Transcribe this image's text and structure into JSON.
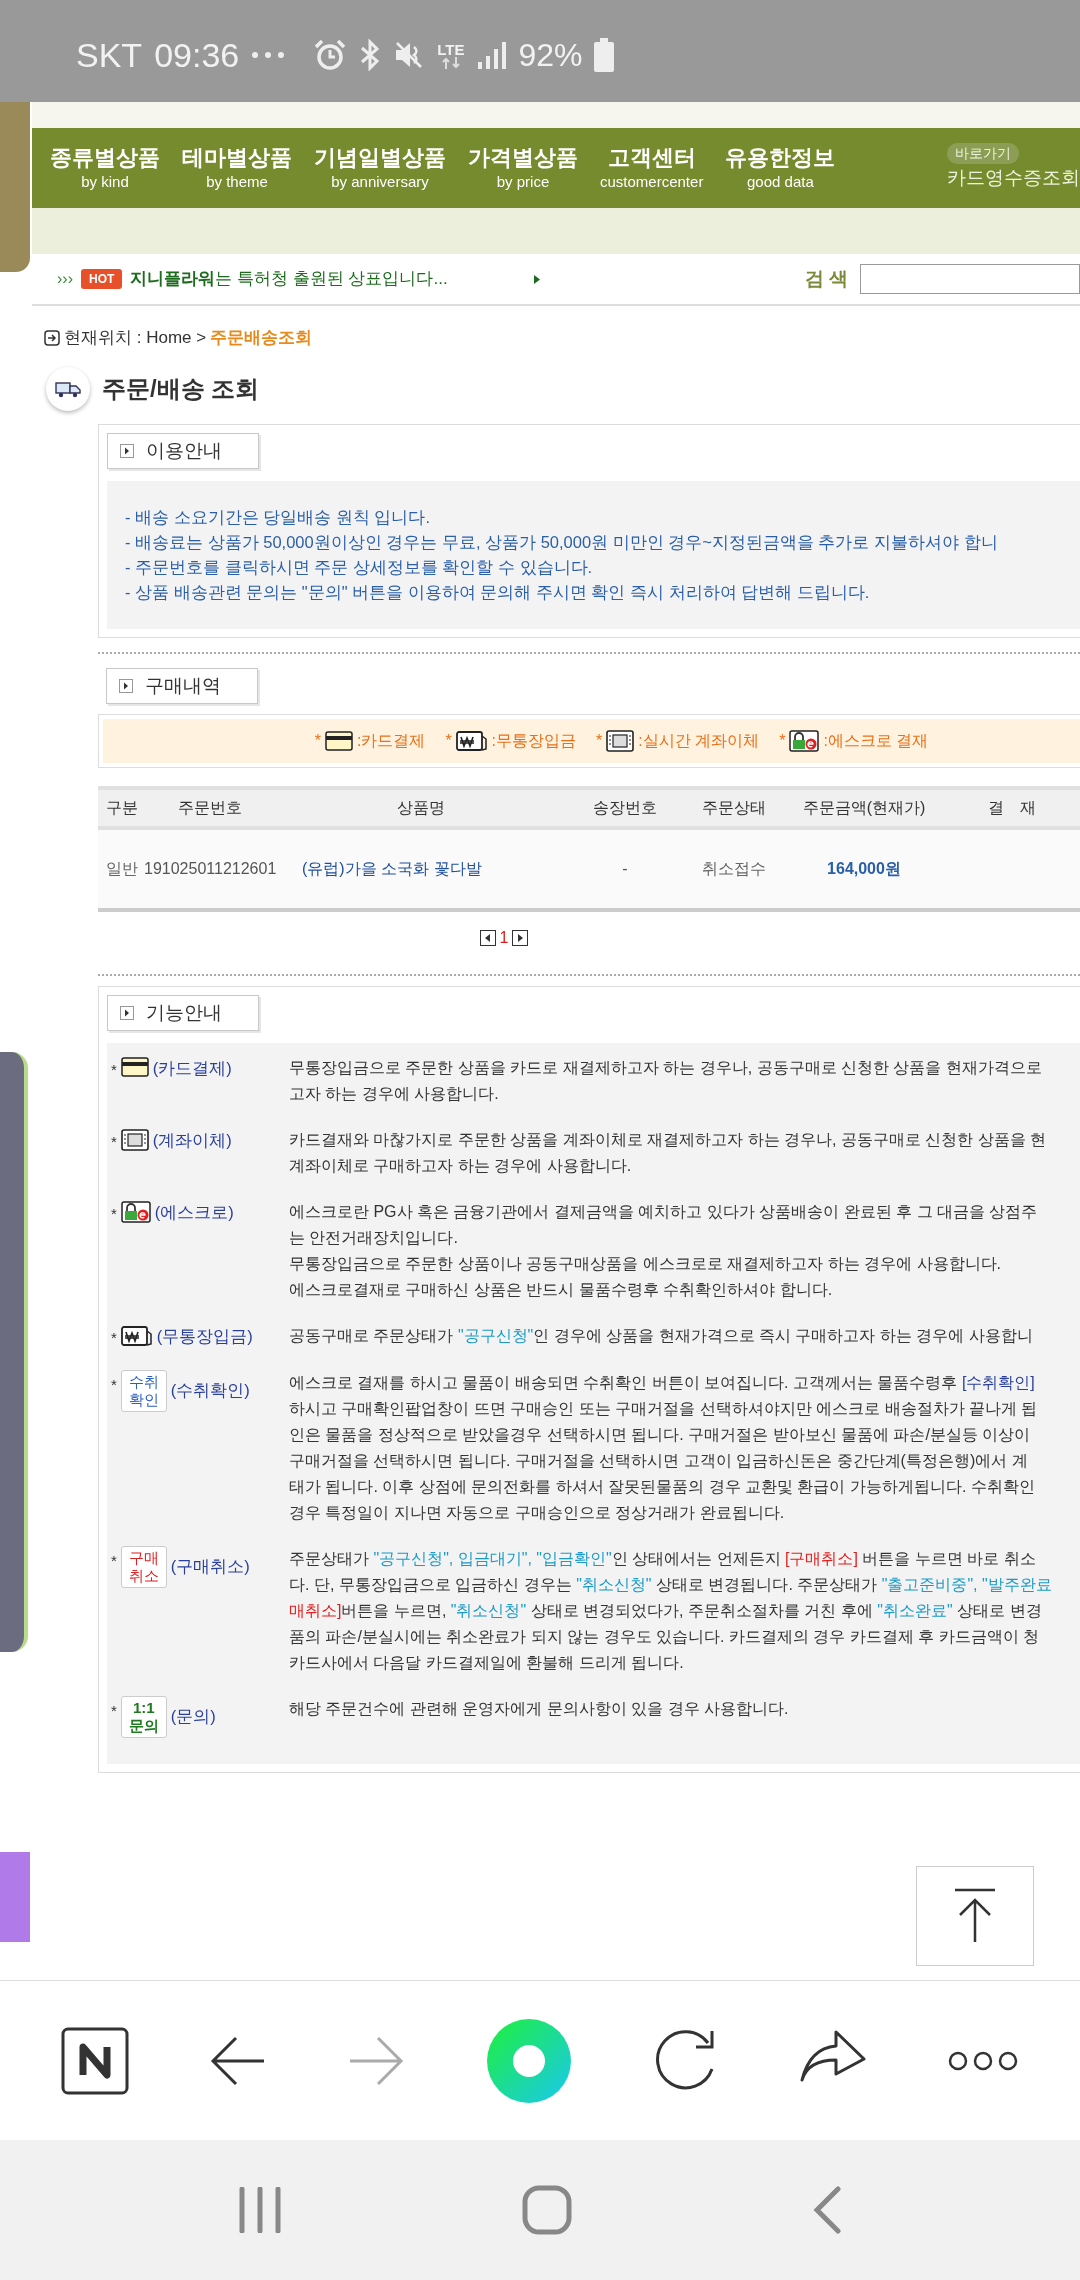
{
  "status_bar": {
    "carrier": "SKT",
    "time": "09:36",
    "network": "LTE",
    "battery": "92%"
  },
  "nav": {
    "items": [
      {
        "label": "종류별상품",
        "sub": "by kind"
      },
      {
        "label": "테마별상품",
        "sub": "by theme"
      },
      {
        "label": "기념일별상품",
        "sub": "by anniversary"
      },
      {
        "label": "가격별상품",
        "sub": "by price"
      },
      {
        "label": "고객센터",
        "sub": "customercenter"
      },
      {
        "label": "유용한정보",
        "sub": "good data"
      }
    ],
    "shortcut": {
      "label": "바로가기",
      "text": "카드영수증조회"
    }
  },
  "ticker": {
    "prefix": "›››",
    "hot": "HOT",
    "text": "**지니플라워**는 특허청 출원된 상표입니다..."
  },
  "search": {
    "label": "검 색"
  },
  "breadcrumb": {
    "path": "현재위치 : Home >",
    "current": "주문배송조회"
  },
  "page_title": "주문/배송 조회",
  "usage": {
    "title": "이용안내",
    "lines": [
      "- 배송 소요기간은 당일배송 원칙 입니다.",
      "- 배송료는 상품가 50,000원이상인 경우는 무료, 상품가 50,000원 미만인 경우~지정된금액을 추가로 지불하셔야 합니",
      "- 주문번호를 클릭하시면 주문 상세정보를 확인할 수 있습니다.",
      "- 상품 배송관련 문의는 \"문의\" 버튼을 이용하여 문의해 주시면 확인 즉시 처리하여 답변해 드립니다."
    ]
  },
  "purchase": {
    "title": "구매내역",
    "legend": [
      {
        "kind": "card",
        "marker": "*",
        "label": ":카드결제"
      },
      {
        "kind": "bankbook",
        "marker": "*",
        "label": ":무통장입금"
      },
      {
        "kind": "transfer",
        "marker": "*",
        "label": ":실시간 계좌이체"
      },
      {
        "kind": "escrow",
        "marker": "*",
        "label": ":에스크로 결재"
      }
    ],
    "columns": [
      "구분",
      "주문번호",
      "상품명",
      "송장번호",
      "주문상태",
      "주문금액(현재가)",
      "결　재"
    ],
    "rows": [
      {
        "type": "일반",
        "order_no": "191025011212601",
        "product": "(유럽)가을 소국화 꽃다발",
        "invoice": "-",
        "status": "취소접수",
        "amount": "164,000원"
      }
    ],
    "pagination": {
      "page": "1"
    }
  },
  "guide": {
    "title": "기능안내",
    "items": [
      {
        "kind": "card",
        "marker": "*",
        "label": "(카드결제)",
        "lines": [
          [
            {
              "kind": "plain",
              "text": "무통장입금으로 주문한 상품을 카드로 재결제하고자 하는 경우나, 공동구매로 신청한 상품을 현재가격으로"
            }
          ],
          [
            {
              "kind": "plain",
              "text": "고자 하는 경우에 사용합니다."
            }
          ]
        ]
      },
      {
        "kind": "transfer",
        "marker": "*",
        "label": "(계좌이체)",
        "lines": [
          [
            {
              "kind": "plain",
              "text": "카드결재와 마찮가지로 주문한 상품을 계좌이체로 재결제하고자 하는 경우나, 공동구매로 신청한 상품을 현"
            }
          ],
          [
            {
              "kind": "plain",
              "text": "계좌이체로 구매하고자 하는 경우에 사용합니다."
            }
          ]
        ]
      },
      {
        "kind": "escrow",
        "marker": "*",
        "label": "(에스크로)",
        "lines": [
          [
            {
              "kind": "plain",
              "text": "에스크로란 PG사 혹은 금융기관에서 결제금액을 예치하고 있다가 상품배송이 완료된 후 그 대금을 상점주"
            }
          ],
          [
            {
              "kind": "plain",
              "text": "는 안전거래장치입니다."
            }
          ],
          [
            {
              "kind": "plain",
              "text": "무통장입금으로 주문한 상품이나 공동구매상품을 에스크로로 재결제하고자 하는 경우에 사용합니다."
            }
          ],
          [
            {
              "kind": "plain",
              "text": "에스크로결재로 구매하신 상품은 반드시 물품수령후 수취확인하셔야 합니다."
            }
          ]
        ]
      },
      {
        "kind": "bankbook",
        "marker": "*",
        "label": "(무통장입금)",
        "lines": [
          [
            {
              "kind": "plain",
              "text": "공동구매로 주문상태가 "
            },
            {
              "kind": "status",
              "text": "\"공구신청\""
            },
            {
              "kind": "plain",
              "text": "인 경우에 상품을 현재가격으로 즉시 구매하고자 하는 경우에 사용합니"
            }
          ]
        ]
      },
      {
        "kind": "confirm",
        "marker": "*",
        "badge": "수취확인",
        "label": "(수취확인)",
        "lines": [
          [
            {
              "kind": "plain",
              "text": "에스크로 결재를 하시고 물품이 배송되면 수취확인 버튼이 보여집니다. 고객께서는 물품수령후 "
            },
            {
              "kind": "link",
              "text": "[수취확인]"
            }
          ],
          [
            {
              "kind": "plain",
              "text": "하시고 구매확인팝업창이 뜨면 구매승인 또는 구매거절을 선택하셔야지만 에스크로 배송절차가 끝나게 됩"
            }
          ],
          [
            {
              "kind": "plain",
              "text": "인은 물품을 정상적으로 받았을경우 선택하시면 됩니다. 구매거절은 받아보신 물품에 파손/분실등 이상이"
            }
          ],
          [
            {
              "kind": "plain",
              "text": "구매거절을 선택하시면 됩니다. 구매거절을 선택하시면 고객이 입금하신돈은 중간단계(특정은행)에서 계"
            }
          ],
          [
            {
              "kind": "plain",
              "text": "태가 됩니다. 이후 상점에 문의전화를 하셔서 잘못된물품의 경우 교환및 환급이 가능하게됩니다. 수취확인"
            }
          ],
          [
            {
              "kind": "plain",
              "text": "경우 특정일이 지나면 자동으로 구매승인으로 정상거래가 완료됩니다."
            }
          ]
        ]
      },
      {
        "kind": "cancel",
        "marker": "*",
        "badge": "구매취소",
        "label": "(구매취소)",
        "lines": [
          [
            {
              "kind": "plain",
              "text": "주문상태가 "
            },
            {
              "kind": "status",
              "text": "\"공구신청\", 입금대기\", \"입금확인\""
            },
            {
              "kind": "plain",
              "text": "인 상태에서는 언제든지 "
            },
            {
              "kind": "warn",
              "text": "[구매취소]"
            },
            {
              "kind": "plain",
              "text": " 버튼을 누르면 바로 취소"
            }
          ],
          [
            {
              "kind": "plain",
              "text": "다. 단, 무통장입금으로 입금하신 경우는 "
            },
            {
              "kind": "status",
              "text": "\"취소신청\""
            },
            {
              "kind": "plain",
              "text": " 상태로 변경됩니다. 주문상태가 "
            },
            {
              "kind": "status",
              "text": "\"출고준비중\", \"발주완료"
            }
          ],
          [
            {
              "kind": "warn",
              "text": "매취소]"
            },
            {
              "kind": "plain",
              "text": "버튼을 누르면, "
            },
            {
              "kind": "status",
              "text": "\"취소신청\""
            },
            {
              "kind": "plain",
              "text": " 상태로 변경되었다가, 주문취소절차를 거친 후에 "
            },
            {
              "kind": "status",
              "text": "\"취소완료\""
            },
            {
              "kind": "plain",
              "text": " 상태로 변경"
            }
          ],
          [
            {
              "kind": "plain",
              "text": "품의 파손/분실시에는 취소완료가 되지 않는 경우도 있습니다. 카드결제의 경우 카드결제 후 카드금액이 청"
            }
          ],
          [
            {
              "kind": "plain",
              "text": "카드사에서 다음달 카드결제일에 환불해 드리게 됩니다."
            }
          ]
        ]
      },
      {
        "kind": "inquiry",
        "marker": "*",
        "badge": "1:1 문의",
        "label": "(문의)",
        "lines": [
          [
            {
              "kind": "plain",
              "text": "해당 주문건수에 관련해 운영자에게 문의사항이 있을 경우 사용합니다."
            }
          ]
        ]
      }
    ]
  }
}
